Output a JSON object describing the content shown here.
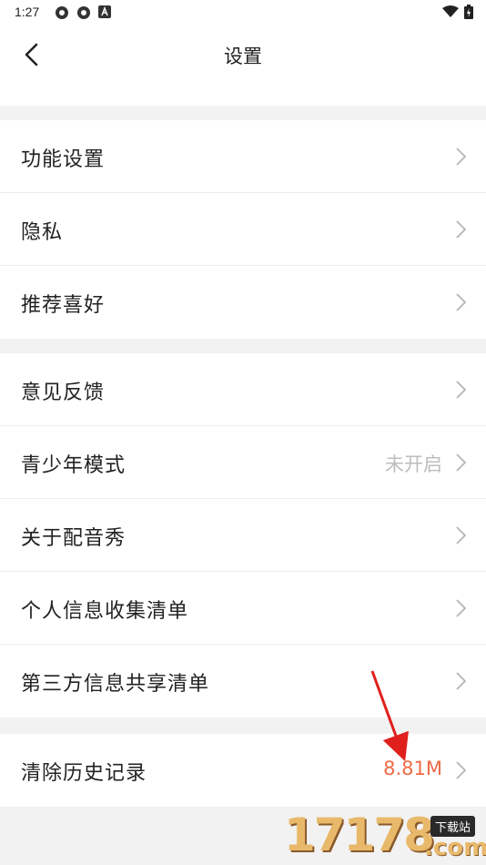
{
  "status_bar": {
    "time": "1:27"
  },
  "header": {
    "title": "设置"
  },
  "groups": [
    {
      "items": [
        {
          "label": "功能设置",
          "value": ""
        },
        {
          "label": "隐私",
          "value": ""
        },
        {
          "label": "推荐喜好",
          "value": ""
        }
      ]
    },
    {
      "items": [
        {
          "label": "意见反馈",
          "value": ""
        },
        {
          "label": "青少年模式",
          "value": "未开启"
        },
        {
          "label": "关于配音秀",
          "value": ""
        },
        {
          "label": "个人信息收集清单",
          "value": ""
        },
        {
          "label": "第三方信息共享清单",
          "value": ""
        }
      ]
    },
    {
      "items": [
        {
          "label": "清除历史记录",
          "value": "8.81M"
        }
      ]
    }
  ],
  "watermark": {
    "digits": "17178",
    "badge": "下载站",
    "domain": ".com"
  },
  "colors": {
    "accent": "#ef6a45",
    "muted": "#bdbdbd",
    "divider": "#f2f2f2"
  }
}
